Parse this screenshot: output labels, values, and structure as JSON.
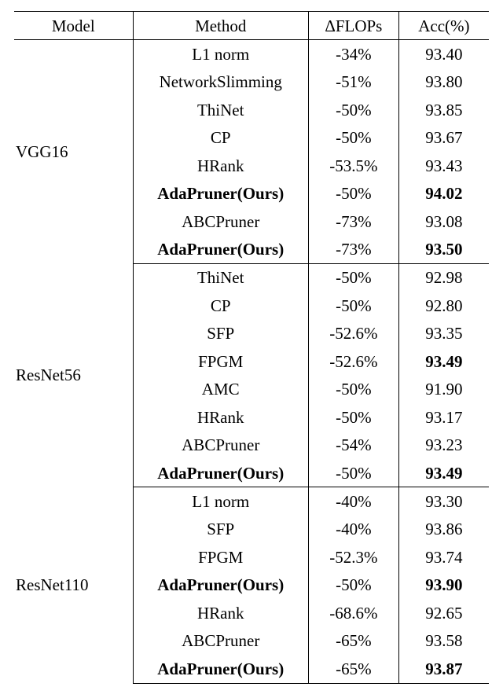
{
  "chart_data": {
    "type": "table",
    "title": "",
    "columns": [
      "Model",
      "Method",
      "ΔFLOPs",
      "Acc(%)"
    ],
    "sections": [
      {
        "model": "VGG16",
        "rows": [
          {
            "method": "L1 norm",
            "flops": "-34%",
            "acc": "93.40",
            "method_bold": false,
            "acc_bold": false
          },
          {
            "method": "NetworkSlimming",
            "flops": "-51%",
            "acc": "93.80",
            "method_bold": false,
            "acc_bold": false
          },
          {
            "method": "ThiNet",
            "flops": "-50%",
            "acc": "93.85",
            "method_bold": false,
            "acc_bold": false
          },
          {
            "method": "CP",
            "flops": "-50%",
            "acc": "93.67",
            "method_bold": false,
            "acc_bold": false
          },
          {
            "method": "HRank",
            "flops": "-53.5%",
            "acc": "93.43",
            "method_bold": false,
            "acc_bold": false
          },
          {
            "method": "AdaPruner(Ours)",
            "flops": "-50%",
            "acc": "94.02",
            "method_bold": true,
            "acc_bold": true
          },
          {
            "method": "ABCPruner",
            "flops": "-73%",
            "acc": "93.08",
            "method_bold": false,
            "acc_bold": false
          },
          {
            "method": "AdaPruner(Ours)",
            "flops": "-73%",
            "acc": "93.50",
            "method_bold": true,
            "acc_bold": true
          }
        ]
      },
      {
        "model": "ResNet56",
        "rows": [
          {
            "method": "ThiNet",
            "flops": "-50%",
            "acc": "92.98",
            "method_bold": false,
            "acc_bold": false
          },
          {
            "method": "CP",
            "flops": "-50%",
            "acc": "92.80",
            "method_bold": false,
            "acc_bold": false
          },
          {
            "method": "SFP",
            "flops": "-52.6%",
            "acc": "93.35",
            "method_bold": false,
            "acc_bold": false
          },
          {
            "method": "FPGM",
            "flops": "-52.6%",
            "acc": "93.49",
            "method_bold": false,
            "acc_bold": true
          },
          {
            "method": "AMC",
            "flops": "-50%",
            "acc": "91.90",
            "method_bold": false,
            "acc_bold": false
          },
          {
            "method": "HRank",
            "flops": "-50%",
            "acc": "93.17",
            "method_bold": false,
            "acc_bold": false
          },
          {
            "method": "ABCPruner",
            "flops": "-54%",
            "acc": "93.23",
            "method_bold": false,
            "acc_bold": false
          },
          {
            "method": "AdaPruner(Ours)",
            "flops": "-50%",
            "acc": "93.49",
            "method_bold": true,
            "acc_bold": true
          }
        ]
      },
      {
        "model": "ResNet110",
        "rows": [
          {
            "method": "L1 norm",
            "flops": "-40%",
            "acc": "93.30",
            "method_bold": false,
            "acc_bold": false
          },
          {
            "method": "SFP",
            "flops": "-40%",
            "acc": "93.86",
            "method_bold": false,
            "acc_bold": false
          },
          {
            "method": "FPGM",
            "flops": "-52.3%",
            "acc": "93.74",
            "method_bold": false,
            "acc_bold": false
          },
          {
            "method": "AdaPruner(Ours)",
            "flops": "-50%",
            "acc": "93.90",
            "method_bold": true,
            "acc_bold": true
          },
          {
            "method": "HRank",
            "flops": "-68.6%",
            "acc": "92.65",
            "method_bold": false,
            "acc_bold": false
          },
          {
            "method": "ABCPruner",
            "flops": "-65%",
            "acc": "93.58",
            "method_bold": false,
            "acc_bold": false
          },
          {
            "method": "AdaPruner(Ours)",
            "flops": "-65%",
            "acc": "93.87",
            "method_bold": true,
            "acc_bold": true
          }
        ]
      }
    ]
  }
}
